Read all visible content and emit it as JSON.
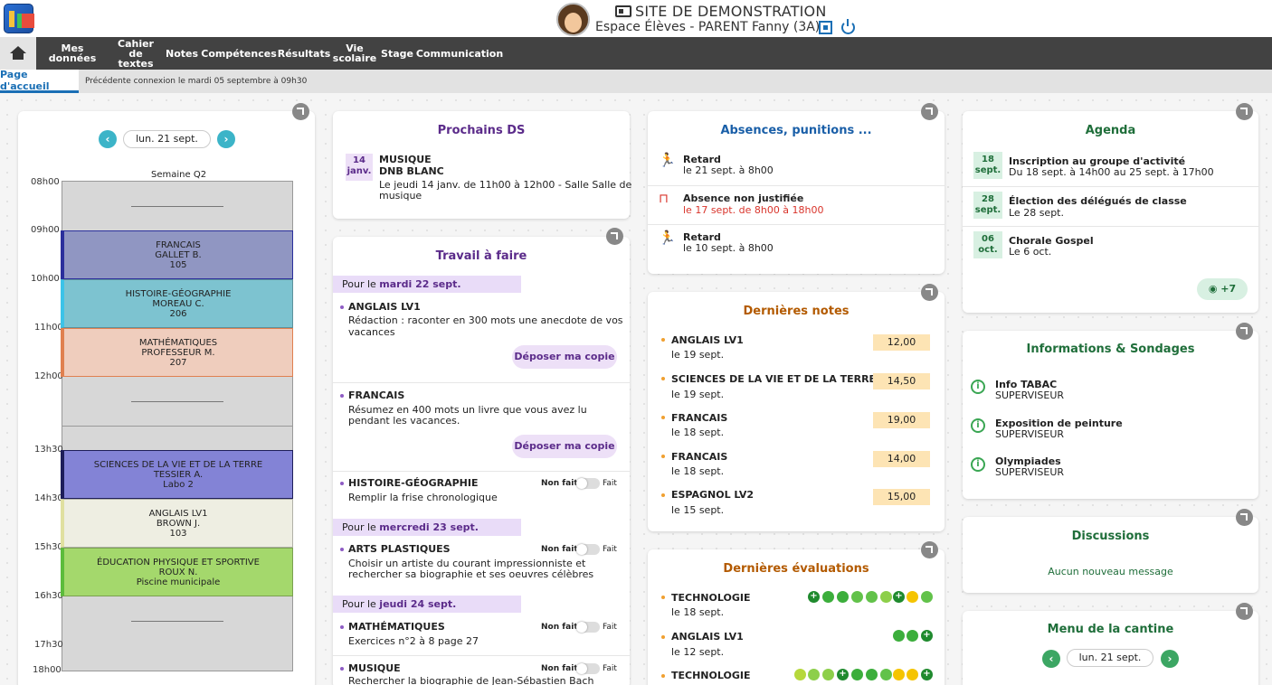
{
  "header": {
    "site_title": "SITE DE DEMONSTRATION",
    "subtitle": "Espace Élèves - PARENT Fanny (3A)"
  },
  "nav": {
    "items": [
      "Mes données",
      "Cahier de textes",
      "Notes",
      "Compétences",
      "Résultats",
      "Vie scolaire",
      "Stage",
      "Communication"
    ]
  },
  "tabs": {
    "active": "Page d'accueil",
    "last_connection": "Précédente connexion le mardi 05 septembre à 09h30"
  },
  "edt": {
    "date": "lun. 21 sept.",
    "week": "Semaine Q2",
    "hours": [
      "08h00",
      "09h00",
      "10h00",
      "11h00",
      "12h00",
      "13h30",
      "14h30",
      "15h30",
      "16h30",
      "17h30",
      "18h00"
    ],
    "courses": [
      {
        "subject": "FRANCAIS",
        "teacher": "GALLET B.",
        "room": "105"
      },
      {
        "subject": "HISTOIRE-GÉOGRAPHIE",
        "teacher": "MOREAU C.",
        "room": "206"
      },
      {
        "subject": "MATHÉMATIQUES",
        "teacher": "PROFESSEUR M.",
        "room": "207"
      },
      {
        "subject": "SCIENCES DE LA VIE ET DE LA TERRE",
        "teacher": "TESSIER A.",
        "room": "Labo 2"
      },
      {
        "subject": "ANGLAIS LV1",
        "teacher": "BROWN J.",
        "room": "103"
      },
      {
        "subject": "ÉDUCATION PHYSIQUE ET SPORTIVE",
        "teacher": "ROUX N.",
        "room": "Piscine municipale"
      }
    ]
  },
  "ds": {
    "title": "Prochains DS",
    "day": "14",
    "month": "janv.",
    "subject": "MUSIQUE",
    "name": "DNB BLANC",
    "detail1": "Le jeudi 14 janv. de 11h00 à 12h00  - Salle Salle de",
    "detail2": "musique"
  },
  "travail": {
    "title": "Travail à faire",
    "pour_prefix": "Pour le",
    "groups": [
      {
        "date": "mardi 22 sept."
      },
      {
        "date": "mercredi 23 sept."
      },
      {
        "date": "jeudi 24 sept."
      }
    ],
    "items": [
      {
        "subject": "ANGLAIS LV1",
        "line1": "Rédaction : raconter en 300 mots une anecdote de vos",
        "line2": "vacances",
        "button": "Déposer ma copie"
      },
      {
        "subject": "FRANCAIS",
        "line1": "Résumez en 400 mots un livre que vous avez lu",
        "line2": "pendant les vacances.",
        "button": "Déposer ma copie"
      },
      {
        "subject": "HISTOIRE-GÉOGRAPHIE",
        "line1": "Remplir la frise chronologique"
      },
      {
        "subject": "ARTS PLASTIQUES",
        "line1": "Choisir un artiste du courant impressionniste et",
        "line2": "rechercher sa biographie et ses oeuvres célèbres"
      },
      {
        "subject": "MATHÉMATIQUES",
        "line1": "Exercices n°2 à 8 page 27"
      },
      {
        "subject": "MUSIQUE",
        "line1": "Rechercher la biographie de Jean-Sébastien Bach"
      }
    ],
    "non_fait": "Non fait",
    "fait": "Fait"
  },
  "absences": {
    "title": "Absences, punitions ...",
    "items": [
      {
        "label": "Retard",
        "detail": "le 21 sept. à 8h00"
      },
      {
        "label": "Absence non justifiée",
        "detail": "le 17 sept. de 8h00 à 18h00"
      },
      {
        "label": "Retard",
        "detail": "le 10 sept. à 8h00"
      }
    ]
  },
  "notes": {
    "title": "Dernières notes",
    "items": [
      {
        "subject": "ANGLAIS LV1",
        "date": "le 19 sept.",
        "grade": "12,00"
      },
      {
        "subject": "SCIENCES DE LA VIE ET DE LA TERRE",
        "date": "le 19 sept.",
        "grade": "14,50"
      },
      {
        "subject": "FRANCAIS",
        "date": "le 18 sept.",
        "grade": "19,00"
      },
      {
        "subject": "FRANCAIS",
        "date": "le 18 sept.",
        "grade": "14,00"
      },
      {
        "subject": "ESPAGNOL LV2",
        "date": "le 15 sept.",
        "grade": "15,00"
      }
    ]
  },
  "evaluations": {
    "title": "Dernières évaluations",
    "items": [
      {
        "subject": "TECHNOLOGIE",
        "date": "le 18 sept."
      },
      {
        "subject": "ANGLAIS LV1",
        "date": "le 12 sept."
      },
      {
        "subject": "TECHNOLOGIE",
        "date": ""
      }
    ]
  },
  "agenda": {
    "title": "Agenda",
    "items": [
      {
        "day": "18",
        "month": "sept.",
        "title": "Inscription au groupe d'activité",
        "detail": "Du 18 sept. à 14h00 au 25 sept. à 17h00"
      },
      {
        "day": "28",
        "month": "sept.",
        "title": "Élection des délégués de classe",
        "detail": "Le 28 sept."
      },
      {
        "day": "06",
        "month": "oct.",
        "title": "Chorale Gospel",
        "detail": "Le 6 oct."
      }
    ],
    "more": "+7"
  },
  "infos": {
    "title": "Informations & Sondages",
    "items": [
      {
        "title": "Info TABAC",
        "author": "SUPERVISEUR"
      },
      {
        "title": "Exposition de peinture",
        "author": "SUPERVISEUR"
      },
      {
        "title": "Olympiades",
        "author": "SUPERVISEUR"
      }
    ]
  },
  "discussions": {
    "title": "Discussions",
    "empty": "Aucun nouveau message"
  },
  "cantine": {
    "title": "Menu de la cantine",
    "date": "lun. 21 sept."
  },
  "colors": {
    "nav_bg": "#424242",
    "accent": "#1a6fb5",
    "purple": "#5b2b8a"
  }
}
